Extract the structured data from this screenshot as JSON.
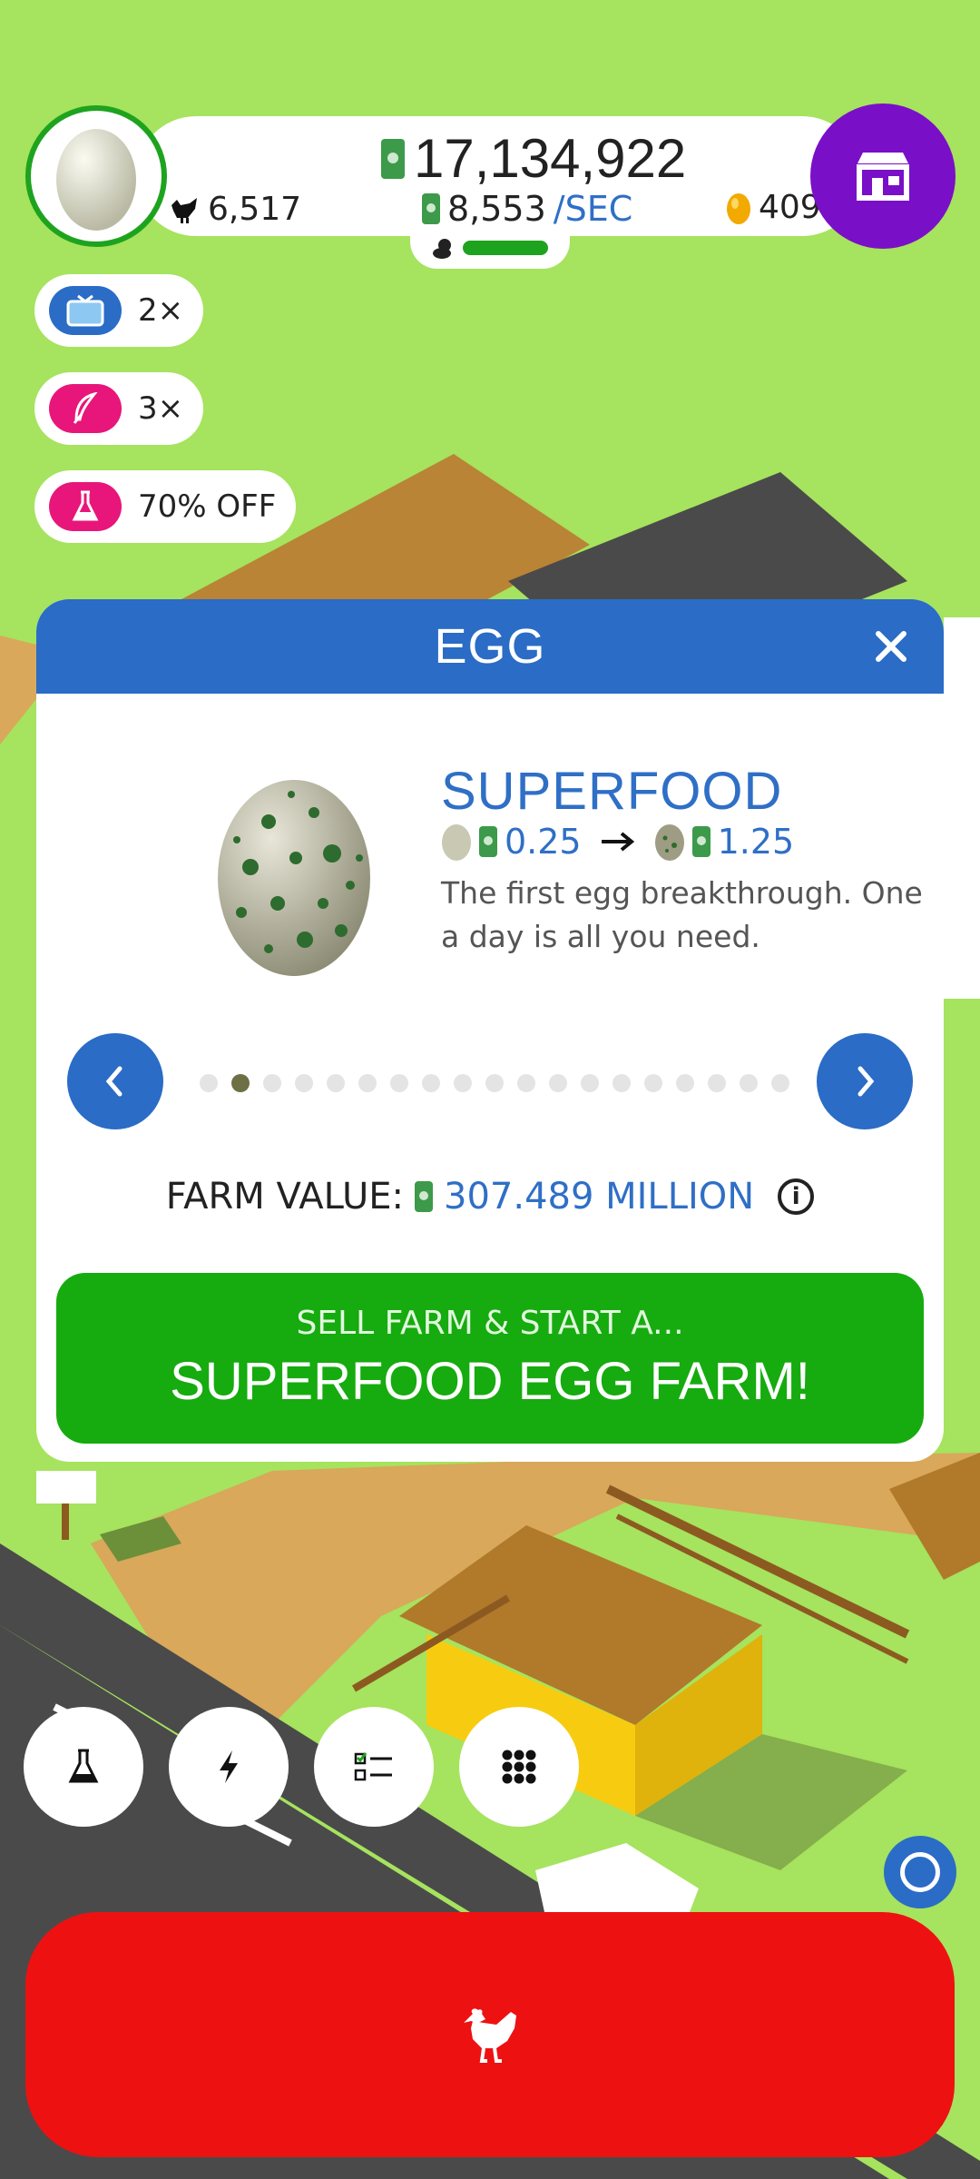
{
  "hud": {
    "money": "17,134,922",
    "rate_value": "8,553",
    "rate_unit": "/SEC",
    "chickens": "6,517",
    "golden_eggs": "409",
    "shop_icon": "shop-icon"
  },
  "boosts": [
    {
      "label": "2×",
      "icon": "tv-icon",
      "color": "#2a6cc6"
    },
    {
      "label": "3×",
      "icon": "feather-icon",
      "color": "#e8167a"
    },
    {
      "label": "70% OFF",
      "icon": "flask-icon",
      "color": "#e8167a"
    }
  ],
  "dialog": {
    "title": "EGG",
    "egg_name": "SUPERFOOD",
    "from_value": "0.25",
    "to_value": "1.25",
    "description": "The first egg breakthrough. One a day is all you need.",
    "page_count": 19,
    "active_page": 2,
    "farm_value_label": "FARM VALUE:",
    "farm_value": "307.489 MILLION",
    "sell_line1": "SELL FARM & START A...",
    "sell_line2": "SUPERFOOD EGG FARM!"
  },
  "bottom": {
    "buttons": [
      "research-flask-icon",
      "boost-lightning-icon",
      "missions-checklist-icon",
      "menu-grid-icon"
    ],
    "hatch_icon": "chicken-icon"
  },
  "colors": {
    "grass": "#a6e35e",
    "dialog_header": "#2a6cc6",
    "sell_button": "#16ab0f",
    "hatch_button": "#ee1111",
    "shop_button": "#7a0fc8"
  }
}
